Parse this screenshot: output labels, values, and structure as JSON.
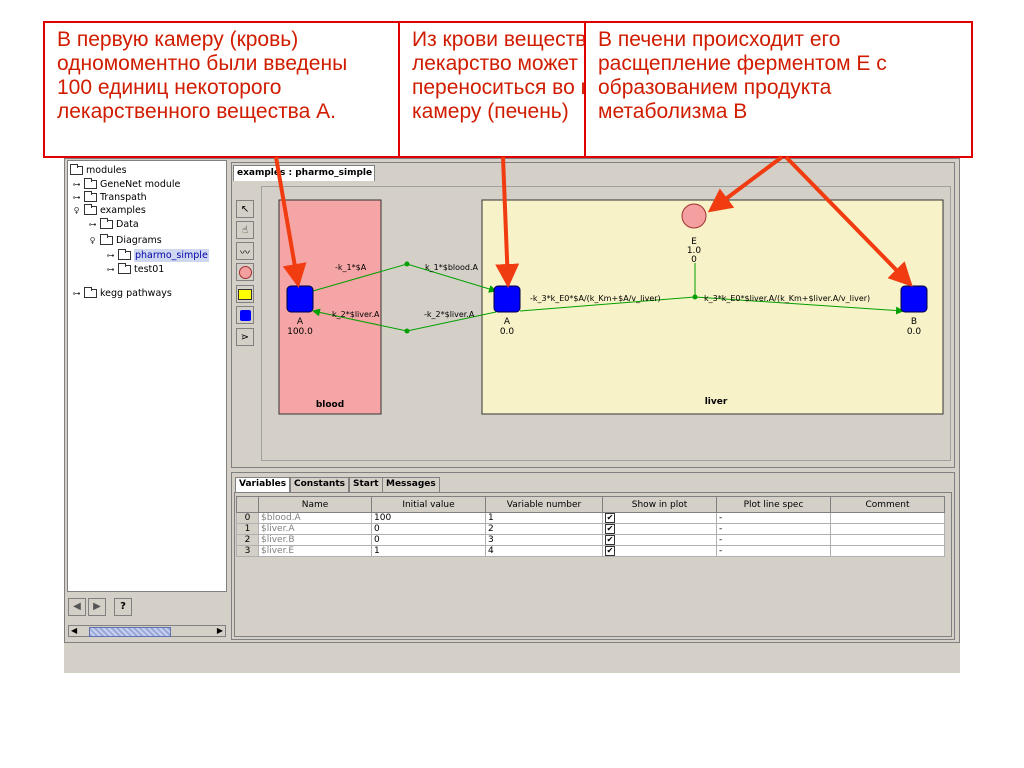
{
  "annotations": [
    {
      "lines": [
        "В первую камеру (кровь)",
        "одномоментно были введены",
        "100 единиц некоторого",
        "лекарственного вещества А."
      ]
    },
    {
      "lines": [
        "Из крови вещество А",
        "лекарство может",
        "переноситься во вторую",
        "камеру (печень)"
      ]
    },
    {
      "lines": [
        "В печени происходит его",
        "расщепление ферментом Е с",
        "образованием продукта",
        "метаболизма В"
      ]
    }
  ],
  "tree": {
    "items": [
      {
        "label": "modules",
        "toggle": ""
      },
      {
        "label": "GeneNet module",
        "toggle": "o-"
      },
      {
        "label": "Transpath",
        "toggle": "o-"
      },
      {
        "label": "examples",
        "toggle": "ф"
      },
      {
        "label": "Data",
        "toggle": "o-"
      },
      {
        "label": "Diagrams",
        "toggle": "ф"
      },
      {
        "label": "pharmo_simple",
        "toggle": "o-"
      },
      {
        "label": "test01",
        "toggle": "o-"
      },
      {
        "label": "kegg pathways",
        "toggle": "o-"
      }
    ]
  },
  "nav": {
    "back": "◀",
    "forward": "▶",
    "help": "?"
  },
  "diagram": {
    "tab_label": "examples : pharmo_simple",
    "blood_label": "blood",
    "liver_label": "liver",
    "nodes": {
      "blood_a_name": "A",
      "blood_a_value": "100.0",
      "liver_a_name": "A",
      "liver_a_value": "0.0",
      "liver_b_name": "B",
      "liver_b_value": "0.0",
      "enzyme_name": "E",
      "enzyme_value": "1.0",
      "enzyme_extra": "0"
    },
    "edges": {
      "k1_a": "-k_1*$A",
      "k1_blood_a": "k_1*$blood.A",
      "k2_liver_a_left": "k_2*$liver.A",
      "k2_liver_a_right": "-k_2*$liver.A",
      "k3_consume": "-k_3*k_E0*$A/(k_Km+$A/v_liver)",
      "k3_produce": "k_3*k_E0*$liver.A/(k_Km+$liver.A/v_liver)"
    },
    "colors": {
      "blood_fill": "#f5a5a5",
      "liver_fill": "#f8f2c8",
      "node_blue": "#0000ff",
      "enzyme_fill": "#f5a0a0",
      "edge_green": "#00a000",
      "arrow_red": "#f03c10"
    }
  },
  "tools": [
    "pointer-icon",
    "hand-icon",
    "wave-icon",
    "circle-icon",
    "yellow-square-icon",
    "blue-square-icon",
    "reaction-icon"
  ],
  "bottom_tabs": [
    "Variables",
    "Constants",
    "Start",
    "Messages"
  ],
  "variables_table": {
    "headers": [
      "",
      "Name",
      "Initial value",
      "Variable number",
      "Show in plot",
      "Plot line spec",
      "Comment"
    ],
    "rows": [
      {
        "idx": "0",
        "name": "$blood.A",
        "initial": "100",
        "number": "1",
        "show": "✔",
        "spec": "-",
        "comment": ""
      },
      {
        "idx": "1",
        "name": "$liver.A",
        "initial": "0",
        "number": "2",
        "show": "✔",
        "spec": "-",
        "comment": ""
      },
      {
        "idx": "2",
        "name": "$liver.B",
        "initial": "0",
        "number": "3",
        "show": "✔",
        "spec": "-",
        "comment": ""
      },
      {
        "idx": "3",
        "name": "$liver.E",
        "initial": "1",
        "number": "4",
        "show": "✔",
        "spec": "-",
        "comment": ""
      }
    ]
  }
}
